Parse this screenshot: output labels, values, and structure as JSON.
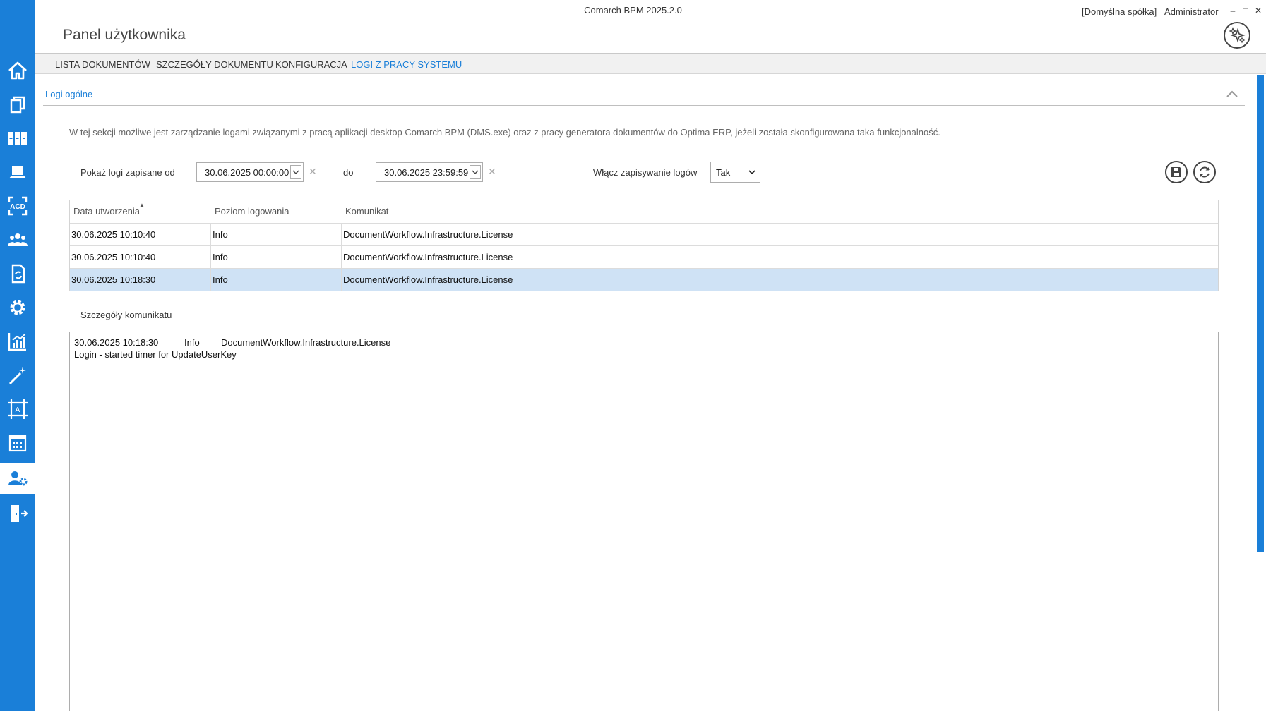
{
  "window": {
    "app_title": "Comarch BPM 2025.2.0",
    "company": "[Domyślna spółka]",
    "user": "Administrator",
    "minimize": "–",
    "maximize": "□",
    "close": "✕"
  },
  "page": {
    "title": "Panel użytkownika"
  },
  "tabs": [
    {
      "label": "LISTA DOKUMENTÓW",
      "active": false
    },
    {
      "label": "SZCZEGÓŁY DOKUMENTU",
      "active": false
    },
    {
      "label": "KONFIGURACJA",
      "active": false
    },
    {
      "label": "LOGI Z PRACY SYSTEMU",
      "active": true
    }
  ],
  "sidebar": {
    "items": [
      {
        "icon": "home-icon"
      },
      {
        "icon": "documents-icon"
      },
      {
        "icon": "binders-icon"
      },
      {
        "icon": "laptop-icon"
      },
      {
        "icon": "acd-icon",
        "text": "ACD"
      },
      {
        "icon": "users-icon"
      },
      {
        "icon": "document-sync-icon"
      },
      {
        "icon": "gear-icon"
      },
      {
        "icon": "bar-chart-icon"
      },
      {
        "icon": "magic-wand-icon"
      },
      {
        "icon": "ocr-frame-icon",
        "text": "A"
      },
      {
        "icon": "calendar-icon"
      },
      {
        "icon": "user-settings-icon",
        "active": true
      },
      {
        "icon": "logout-icon"
      }
    ]
  },
  "section": {
    "title": "Logi ogólne",
    "description": "W tej sekcji możliwe jest zarządzanie logami związanymi z pracą aplikacji desktop  Comarch BPM (DMS.exe) oraz z pracy generatora dokumentów do Optima ERP, jeżeli została skonfigurowana taka funkcjonalność."
  },
  "filters": {
    "from_label": "Pokaż logi zapisane od",
    "from_value": "30.06.2025 00:00:00",
    "to_label": "do",
    "to_value": "30.06.2025 23:59:59",
    "clear_symbol": "✕",
    "logging_label": "Włącz zapisywanie logów",
    "logging_value": "Tak"
  },
  "grid": {
    "columns": [
      "Data utworzenia",
      "Poziom logowania",
      "Komunikat"
    ],
    "sort_indicator": "▲",
    "rows": [
      {
        "date": "30.06.2025 10:10:40",
        "level": "Info",
        "message": "DocumentWorkflow.Infrastructure.License",
        "selected": false
      },
      {
        "date": "30.06.2025 10:10:40",
        "level": "Info",
        "message": "DocumentWorkflow.Infrastructure.License",
        "selected": false
      },
      {
        "date": "30.06.2025 10:18:30",
        "level": "Info",
        "message": "DocumentWorkflow.Infrastructure.License",
        "selected": true
      }
    ]
  },
  "details": {
    "label": "Szczegóły komunikatu",
    "date": "30.06.2025 10:18:30",
    "level": "Info",
    "source": "DocumentWorkflow.Infrastructure.License",
    "message": "Login - started timer for UpdateUserKey"
  },
  "colors": {
    "accent": "#1a7fd8",
    "selected_row": "#cfe2f5"
  }
}
